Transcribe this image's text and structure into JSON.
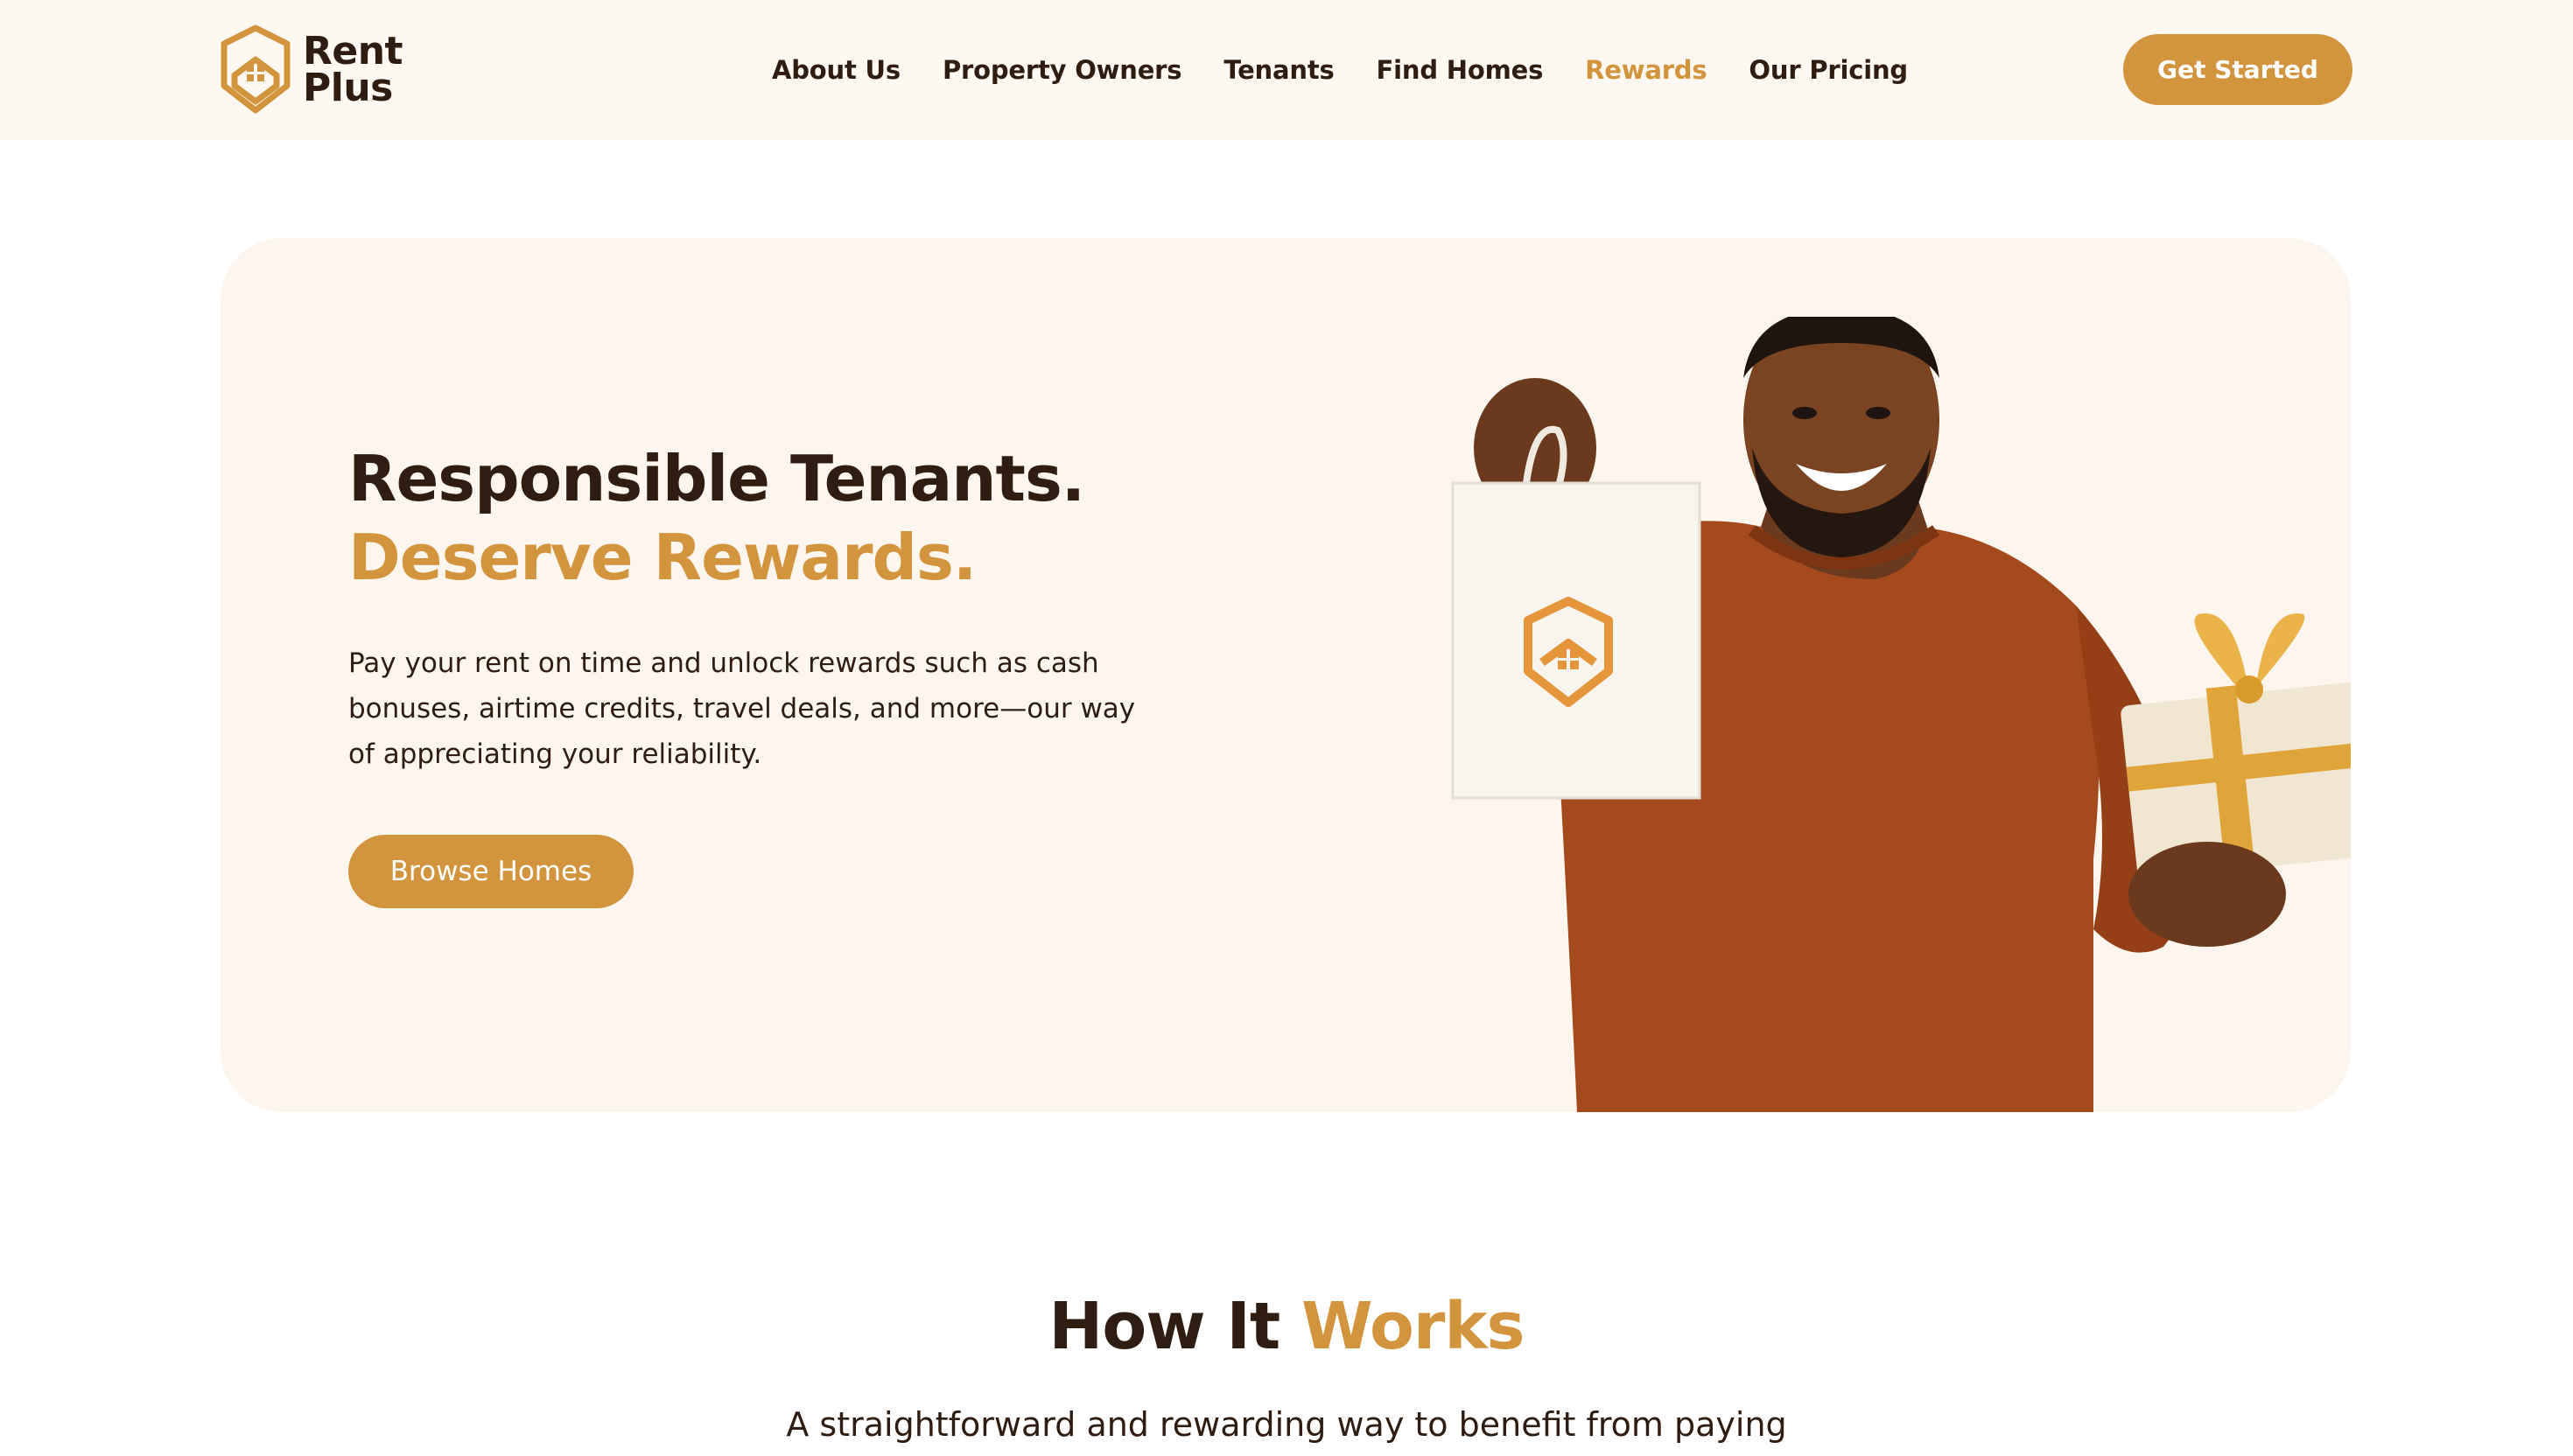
{
  "header": {
    "logo": {
      "line1": "Rent",
      "line2": "Plus",
      "icon": "house-shield-icon"
    },
    "nav": [
      {
        "label": "About Us",
        "active": false
      },
      {
        "label": "Property Owners",
        "active": false
      },
      {
        "label": "Tenants",
        "active": false
      },
      {
        "label": "Find Homes",
        "active": false
      },
      {
        "label": "Rewards",
        "active": true
      },
      {
        "label": "Our Pricing",
        "active": false
      }
    ],
    "cta_label": "Get Started"
  },
  "hero": {
    "title_line1": "Responsible Tenants.",
    "title_line2": "Deserve Rewards.",
    "description": "Pay your rent on time and unlock rewards such as cash bonuses, airtime credits, travel deals, and more—our way of appreciating your reliability.",
    "button_label": "Browse Homes"
  },
  "how_it_works": {
    "title_dark": "How It",
    "title_gold": "Works",
    "subtitle": "A straightforward and rewarding way to benefit from paying"
  },
  "colors": {
    "accent": "#d2943c",
    "text_dark": "#2e1d10",
    "header_bg": "#fdf8f1",
    "hero_bg": "#fdf6ef"
  }
}
